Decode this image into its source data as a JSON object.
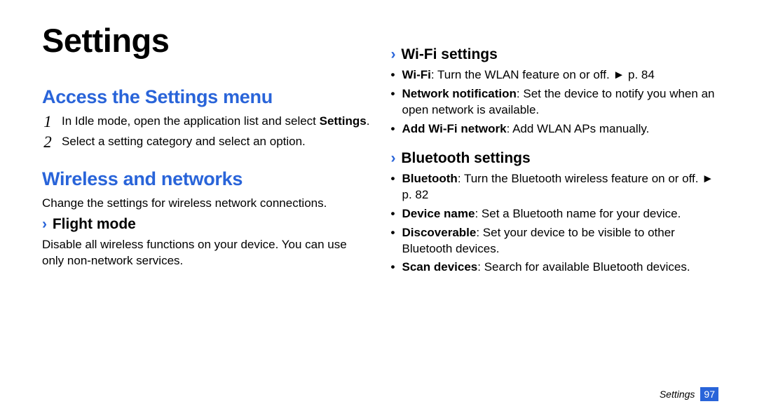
{
  "page_title": "Settings",
  "left": {
    "access_heading": "Access the Settings menu",
    "step1_a": "In Idle mode, open the application list and select ",
    "step1_b": "Settings",
    "step1_c": ".",
    "step2": "Select a setting category and select an option.",
    "wireless_heading": "Wireless and networks",
    "wireless_intro": "Change the settings for wireless network connections.",
    "flight_heading": "Flight mode",
    "flight_body": "Disable all wireless functions on your device. You can use only non-network services."
  },
  "right": {
    "wifi_heading": "Wi-Fi settings",
    "wifi_b1_a": "Wi-Fi",
    "wifi_b1_b": ": Turn the WLAN feature on or off. ",
    "wifi_b1_c": "►",
    "wifi_b1_d": " p. 84",
    "wifi_b2_a": "Network notification",
    "wifi_b2_b": ": Set the device to notify you when an open network is available.",
    "wifi_b3_a": "Add Wi-Fi network",
    "wifi_b3_b": ": Add WLAN APs manually.",
    "bt_heading": "Bluetooth settings",
    "bt_b1_a": "Bluetooth",
    "bt_b1_b": ": Turn the Bluetooth wireless feature on or off. ",
    "bt_b1_c": "►",
    "bt_b1_d": " p. 82",
    "bt_b2_a": "Device name",
    "bt_b2_b": ": Set a Bluetooth name for your device.",
    "bt_b3_a": "Discoverable",
    "bt_b3_b": ": Set your device to be visible to other Bluetooth devices.",
    "bt_b4_a": "Scan devices",
    "bt_b4_b": ": Search for available Bluetooth devices."
  },
  "footer": {
    "label": "Settings",
    "page": "97"
  },
  "numbers": {
    "one": "1",
    "two": "2"
  },
  "chevron": "›",
  "bullet": "•"
}
